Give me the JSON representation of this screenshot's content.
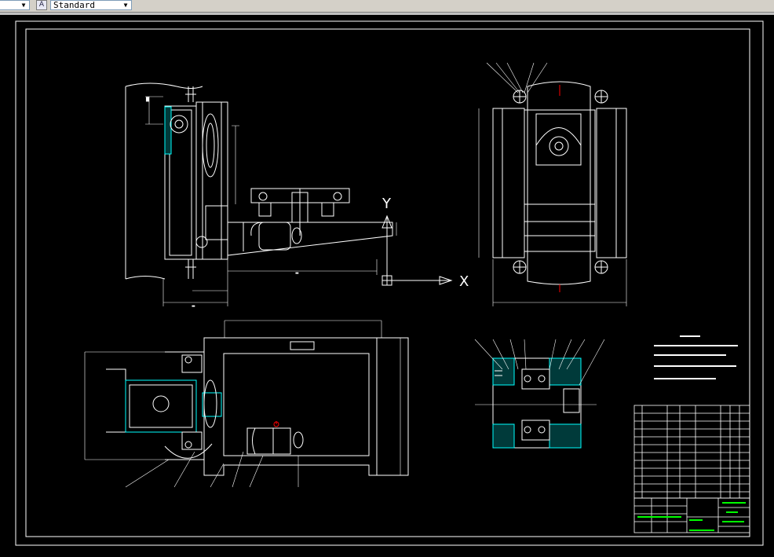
{
  "toolbar": {
    "layer_dropdown": {
      "value": ""
    },
    "text_style_icon": "text-style-icon",
    "text_style_dropdown": {
      "value": "Standard"
    }
  },
  "drawing": {
    "ucs_y_label": "Y",
    "ucs_x_label": "X",
    "colors": {
      "background": "#000000",
      "lines": "#ffffff",
      "section": "#00ffff",
      "dimension": "#ff0000",
      "title_text": "#00ff00"
    }
  }
}
